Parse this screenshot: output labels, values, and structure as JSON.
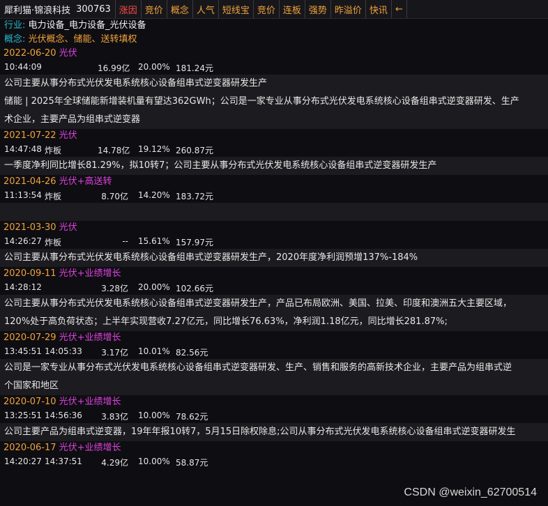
{
  "header": {
    "stock_name": "犀利猫·锦浪科技",
    "stock_code": "300763",
    "tabs": [
      {
        "label": "涨因",
        "active": true
      },
      {
        "label": "竞价",
        "active": false
      },
      {
        "label": "概念",
        "active": false
      },
      {
        "label": "人气",
        "active": false
      },
      {
        "label": "短线宝",
        "active": false
      },
      {
        "label": "竞价",
        "active": false
      },
      {
        "label": "连板",
        "active": false
      },
      {
        "label": "强势",
        "active": false
      },
      {
        "label": "昨溢价",
        "active": false
      },
      {
        "label": "快讯",
        "active": false
      },
      {
        "label": "←",
        "active": false
      }
    ]
  },
  "info": {
    "industry_label": "行业:",
    "industry_value": "电力设备_电力设备_光伏设备",
    "concept_label": "概念:",
    "concept_value": "光伏概念、储能、送转填权"
  },
  "events": [
    {
      "date": "2022-06-20",
      "tag": "光伏",
      "row": {
        "time": "10:44:09",
        "type": "",
        "amount": "16.99亿",
        "pct": "20.00%",
        "price": "181.24元"
      },
      "desc": [
        "公司主要从事分布式光伏发电系统核心设备组串式逆变器研发生产",
        "储能 | 2025年全球储能新增装机量有望达362GWh；公司是一家专业从事分布式光伏发电系统核心设备组串式逆变器研发、生产",
        "术企业，主要产品为组串式逆变器"
      ]
    },
    {
      "date": "2021-07-22",
      "tag": "光伏",
      "row": {
        "time": "14:47:48",
        "type": "炸板",
        "amount": "14.78亿",
        "pct": "19.12%",
        "price": "260.87元"
      },
      "desc": [
        "一季度净利同比增长81.29%，拟10转7；公司主要从事分布式光伏发电系统核心设备组串式逆变器研发生产"
      ]
    },
    {
      "date": "2021-04-26",
      "tag": "光伏+高送转",
      "row": {
        "time": "11:13:54",
        "type": "炸板",
        "amount": "8.70亿",
        "pct": "14.20%",
        "price": "183.72元"
      },
      "desc": [
        ""
      ]
    },
    {
      "date": "2021-03-30",
      "tag": "光伏",
      "row": {
        "time": "14:26:27",
        "type": "炸板",
        "amount": "--",
        "pct": "15.61%",
        "price": "157.97元"
      },
      "desc": [
        "公司主要从事分布式光伏发电系统核心设备组串式逆变器研发生产，2020年度净利润预增137%-184%"
      ]
    },
    {
      "date": "2020-09-11",
      "tag": "光伏+业绩增长",
      "row": {
        "time": "14:28:12",
        "type": "",
        "amount": "3.28亿",
        "pct": "20.00%",
        "price": "102.66元"
      },
      "desc": [
        "公司主要从事分布式光伏发电系统核心设备组串式逆变器研发生产，产品已布局欧洲、美国、拉美、印度和澳洲五大主要区域，",
        "120%处于高负荷状态；上半年实现营收7.27亿元，同比增长76.63%，净利润1.18亿元，同比增长281.87%;"
      ]
    },
    {
      "date": "2020-07-29",
      "tag": "光伏+业绩增长",
      "row": {
        "time": "13:45:51",
        "type": "14:05:33",
        "amount": "3.17亿",
        "pct": "10.01%",
        "price": "82.56元"
      },
      "desc": [
        "公司是一家专业从事分布式光伏发电系统核心设备组串式逆变器研发、生产、销售和服务的高新技术企业，主要产品为组串式逆",
        "个国家和地区"
      ]
    },
    {
      "date": "2020-07-10",
      "tag": "光伏+业绩增长",
      "row": {
        "time": "13:25:51",
        "type": "14:56:36",
        "amount": "3.83亿",
        "pct": "10.00%",
        "price": "78.62元"
      },
      "desc": [
        "公司主要产品为组串式逆变器，19年年报10转7，5月15日除权除息;公司从事分布式光伏发电系统核心设备组串式逆变器研发生"
      ]
    },
    {
      "date": "2020-06-17",
      "tag": "光伏+业绩增长",
      "row": {
        "time": "14:20:27",
        "type": "14:37:51",
        "amount": "4.29亿",
        "pct": "10.00%",
        "price": "58.87元"
      },
      "desc": []
    }
  ],
  "watermark": "CSDN @weixin_62700514"
}
